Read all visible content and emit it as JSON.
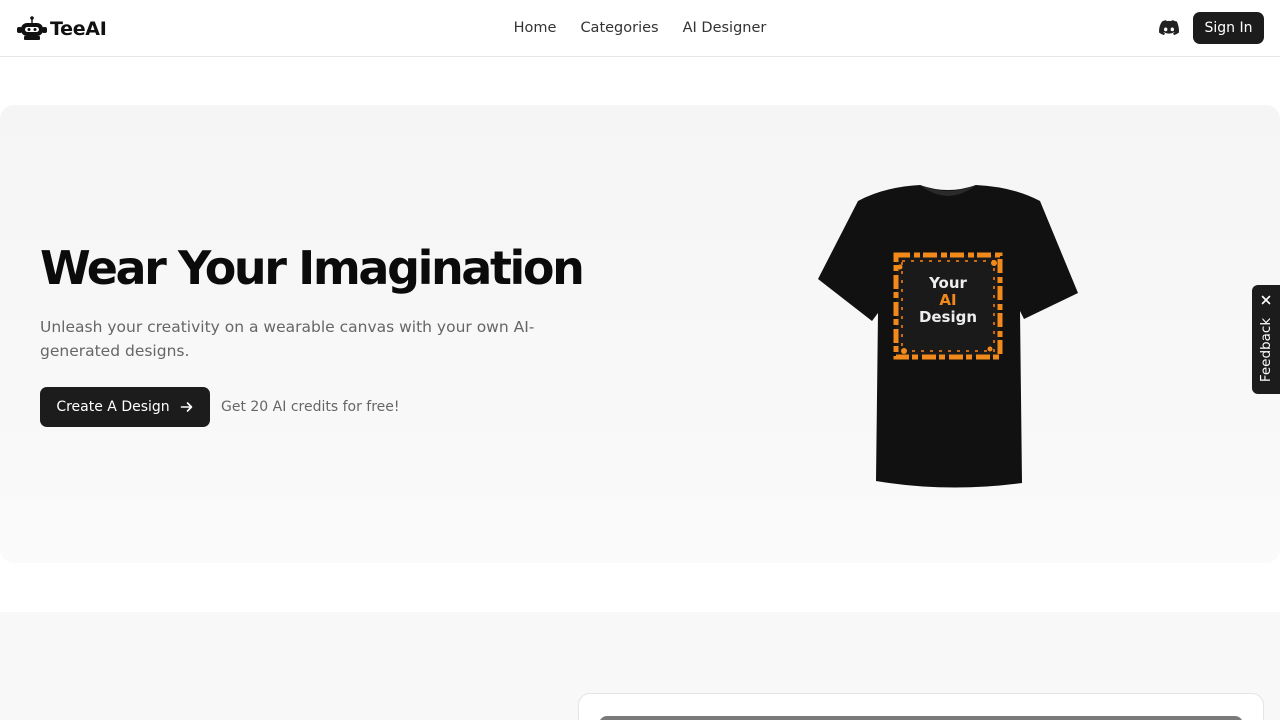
{
  "brand": {
    "name": "TeeAI"
  },
  "nav": {
    "items": [
      {
        "label": "Home"
      },
      {
        "label": "Categories"
      },
      {
        "label": "AI Designer"
      }
    ]
  },
  "header": {
    "discord_icon": "discord-icon",
    "signin_label": "Sign In"
  },
  "hero": {
    "title": "Wear Your Imagination",
    "subtitle": "Unleash your creativity on a wearable canvas with your own AI-generated designs.",
    "cta_label": "Create A Design",
    "cta_icon": "arrow-right-icon",
    "cta_note": "Get 20 AI credits for free!",
    "shirt_text": {
      "line1": "Your",
      "line2": "AI",
      "line3": "Design"
    }
  },
  "feedback": {
    "label": "Feedback",
    "icon": "close-icon"
  },
  "colors": {
    "accent": "#f28a1b",
    "dark": "#1c1c1c",
    "hero_bg": "#f5f5f5"
  }
}
